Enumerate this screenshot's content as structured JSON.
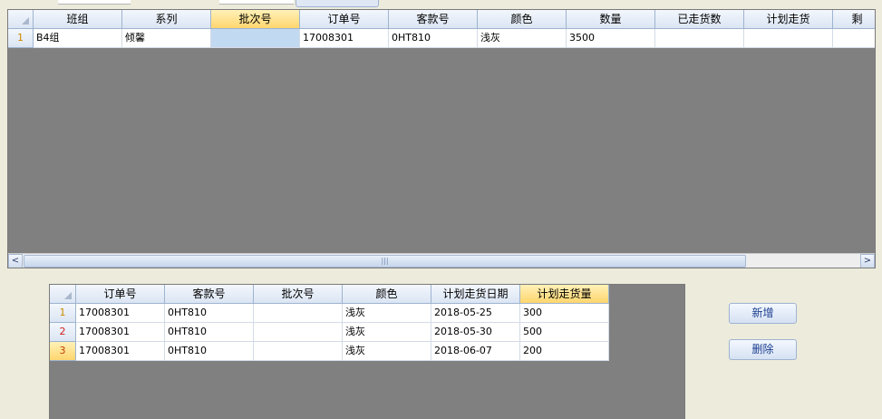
{
  "top_grid": {
    "columns": [
      "",
      "班组",
      "系列",
      "批次号",
      "订单号",
      "客款号",
      "颜色",
      "数量",
      "已走货数",
      "计划走货",
      "剩"
    ],
    "selected_column": "批次号",
    "rows": [
      {
        "num": "1",
        "cells": [
          "B4组",
          "倾馨",
          "",
          "17008301",
          "0HT810",
          "浅灰",
          "3500",
          "",
          "",
          ""
        ]
      }
    ],
    "scrollbar": {
      "left": "<",
      "right": ">",
      "grip": "|||"
    }
  },
  "bottom_grid": {
    "columns": [
      "",
      "订单号",
      "客款号",
      "批次号",
      "颜色",
      "计划走货日期",
      "计划走货量"
    ],
    "selected_column": "计划走货量",
    "rows": [
      {
        "num": "1",
        "cells": [
          "17008301",
          "0HT810",
          "",
          "浅灰",
          "2018-05-25",
          "300"
        ]
      },
      {
        "num": "2",
        "cells": [
          "17008301",
          "0HT810",
          "",
          "浅灰",
          "2018-05-30",
          "500"
        ]
      },
      {
        "num": "3",
        "cells": [
          "17008301",
          "0HT810",
          "",
          "浅灰",
          "2018-06-07",
          "200"
        ]
      }
    ]
  },
  "buttons": {
    "add": "新增",
    "delete": "删除"
  },
  "colors": {
    "header": "#dbe5f3",
    "selected_header": "#ffd66e",
    "grid_bg": "#808080",
    "active_cell": "#c2d9f2"
  }
}
